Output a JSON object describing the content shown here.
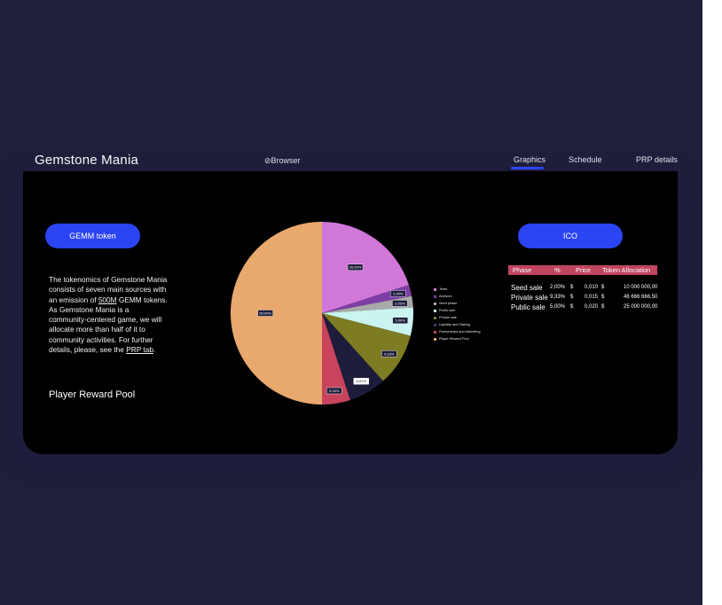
{
  "header": {
    "app_title": "Gemstone Mania",
    "browser_link": "⊘Browser",
    "tabs": [
      {
        "label": "Graphics",
        "active": true
      },
      {
        "label": "Schedule",
        "active": false
      },
      {
        "label": "PRP details",
        "active": false
      }
    ]
  },
  "left": {
    "gemm_button": "GEMM token",
    "desc_1": "The tokenomics of Gemstone Mania consists of seven main sources with an emission of ",
    "desc_link_500m": "500M",
    "desc_2": " GEMM tokens. As Gemstone Mania is a community-centered game, we will allocate more than half of it to community activities. For further details, please, see the ",
    "desc_link_prp": "PRP tab",
    "desc_3": ".",
    "section_label": "Player Reward Pool"
  },
  "right": {
    "ico_button": "ICO",
    "table": {
      "headers": [
        "Phase",
        "%",
        "Price",
        "Token Allocation"
      ],
      "rows": [
        {
          "phase": "Seed sale",
          "pct": "2,00%",
          "cur": "$",
          "price": "0,010",
          "cur2": "$",
          "alloc": "10 000 000,00"
        },
        {
          "phase": "Private sale",
          "pct": "9,33%",
          "cur": "$",
          "price": "0,015",
          "cur2": "$",
          "alloc": "46 666 666,50"
        },
        {
          "phase": "Public sale",
          "pct": "5,00%",
          "cur": "$",
          "price": "0,020",
          "cur2": "$",
          "alloc": "25 000 000,00"
        }
      ]
    }
  },
  "chart_data": {
    "type": "pie",
    "title": "",
    "start_angle_deg": 0,
    "slices": [
      {
        "name": "Team",
        "value": 20.0,
        "label": "20,00%",
        "color": "#d077d8"
      },
      {
        "name": "Advisors",
        "value": 2.0,
        "label": "2,00%",
        "color": "#7d3fa6"
      },
      {
        "name": "Seed phase",
        "value": 2.0,
        "label": "2,00%",
        "color": "#a9a9a9"
      },
      {
        "name": "Public sale",
        "value": 5.0,
        "label": "5,00%",
        "color": "#c9f4f0"
      },
      {
        "name": "Private sale",
        "value": 9.33,
        "label": "9,33%",
        "color": "#7e7c22"
      },
      {
        "name": "Liquidity and Staking",
        "value": 6.67,
        "label": "6,67%",
        "color": "#1d1c3a"
      },
      {
        "name": "Partnerships and Marketing",
        "value": 5.0,
        "label": "5,00%",
        "color": "#c8445d"
      },
      {
        "name": "Player Reward Pool",
        "value": 50.0,
        "label": "50,00%",
        "color": "#e9a86d"
      }
    ]
  }
}
